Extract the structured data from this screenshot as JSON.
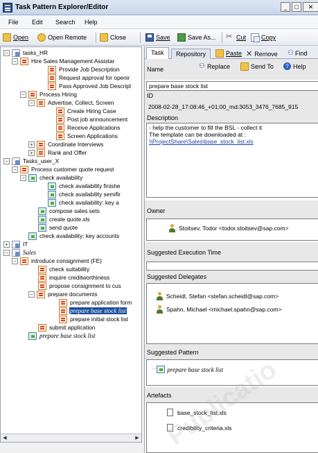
{
  "window": {
    "title": "Task Pattern Explorer/Editor"
  },
  "menu": [
    "File",
    "Edit",
    "Search",
    "Help"
  ],
  "toolbar": {
    "open": "Open",
    "open_remote": "Open Remote",
    "close": "Close",
    "save": "Save",
    "save_as": "Save As...",
    "cut": "Cut",
    "copy": "Copy"
  },
  "tree": [
    {
      "label": "tasks_HR",
      "icon": "folder-icon"
    },
    {
      "label": "Hire Sales Management Assistar",
      "icon": "task-icon"
    },
    {
      "label": "Provide Job Description",
      "icon": "task-icon"
    },
    {
      "label": "Request approval for openir",
      "icon": "task-icon"
    },
    {
      "label": "Pass Approved Job Descript",
      "icon": "task-icon"
    },
    {
      "label": "Process Hiring",
      "icon": "task-icon"
    },
    {
      "label": "Advertise, Collect, Screen",
      "icon": "task-icon"
    },
    {
      "label": "Create Hiring Case",
      "icon": "task-icon"
    },
    {
      "label": "Post job announcement",
      "icon": "task-icon"
    },
    {
      "label": "Receive Applications",
      "icon": "task-icon"
    },
    {
      "label": "Screen Applications",
      "icon": "task-icon"
    },
    {
      "label": "Coordinate Interviews",
      "icon": "task-icon"
    },
    {
      "label": "Rank and Offer",
      "icon": "task-icon"
    },
    {
      "label": "Tasks_user_X",
      "icon": "folder-icon"
    },
    {
      "label": "Process customer quote request",
      "icon": "task-icon"
    },
    {
      "label": "check availability",
      "icon": "stack-icon"
    },
    {
      "label": "check availability finishe",
      "icon": "stack-icon"
    },
    {
      "label": "check availability semifir",
      "icon": "stack-icon"
    },
    {
      "label": "check availability: key a",
      "icon": "stack-icon"
    },
    {
      "label": "compose sales sets",
      "icon": "stack-icon"
    },
    {
      "label": "create quote.xls",
      "icon": "stack-icon"
    },
    {
      "label": "send quote",
      "icon": "stack-icon"
    },
    {
      "label": "check availability: key accounts",
      "icon": "stack-icon"
    },
    {
      "label": "IT",
      "icon": "folder-icon"
    },
    {
      "label": "Sales",
      "icon": "folder-icon"
    },
    {
      "label": "introduce consignment (FE)",
      "icon": "task-icon"
    },
    {
      "label": "check suitability",
      "icon": "task-icon"
    },
    {
      "label": "inquire creditworthiness",
      "icon": "task-icon"
    },
    {
      "label": "propose consignment to cus",
      "icon": "task-icon"
    },
    {
      "label": "prepare documents",
      "icon": "task-icon"
    },
    {
      "label": "prepare application form",
      "icon": "task-icon"
    },
    {
      "label": "prepare base stock list",
      "icon": "task-icon"
    },
    {
      "label": "prepare initial stock list",
      "icon": "task-icon"
    },
    {
      "label": "submit application",
      "icon": "task-icon"
    },
    {
      "label": "prepare base stock list",
      "icon": "stack-icon"
    }
  ],
  "tabs": {
    "task": "Task",
    "repository": "Repository"
  },
  "actions": {
    "paste": "Paste",
    "remove": "Remove",
    "find": "Find",
    "replace": "Replace",
    "send_to": "Send To",
    "help": "Help"
  },
  "fields": {
    "name_label": "Name",
    "name_value": "prepare base stock list",
    "id_label": "ID",
    "id_value": "2008-02-28_17:08:46_+01:00_md:3053_3476_7685_915",
    "description_label": "Description",
    "description_lines": [
      "- help the customer to fill the BSL - collect it",
      "The template can be downloaded at :"
    ],
    "description_link": "\\\\ProjectShare\\Sales\\base_stock_list.xls",
    "owner_label": "Owner",
    "owner": "Stoitsev, Todor <todor.stoitsev@sap.com>",
    "execution_time_label": "Suggested Execution Time",
    "execution_time_value": "",
    "delegates_label": "Suggested Delegates",
    "delegates": [
      "Scheidl, Stefan <stefan.scheidl@sap.com>",
      "Spahn, Michael <michael.spahn@sap.com>"
    ],
    "pattern_label": "Suggested Pattern",
    "pattern_value": "prepare base stock list",
    "artefacts_label": "Artefacts",
    "artefacts": [
      "base_stock_list.xls",
      "credibility_criteria.xls"
    ]
  },
  "watermark": "Publicatio",
  "colors": {
    "selection": "#1a4d9c",
    "link": "#1e3ea8",
    "section_gray": "#e8e8e8"
  }
}
